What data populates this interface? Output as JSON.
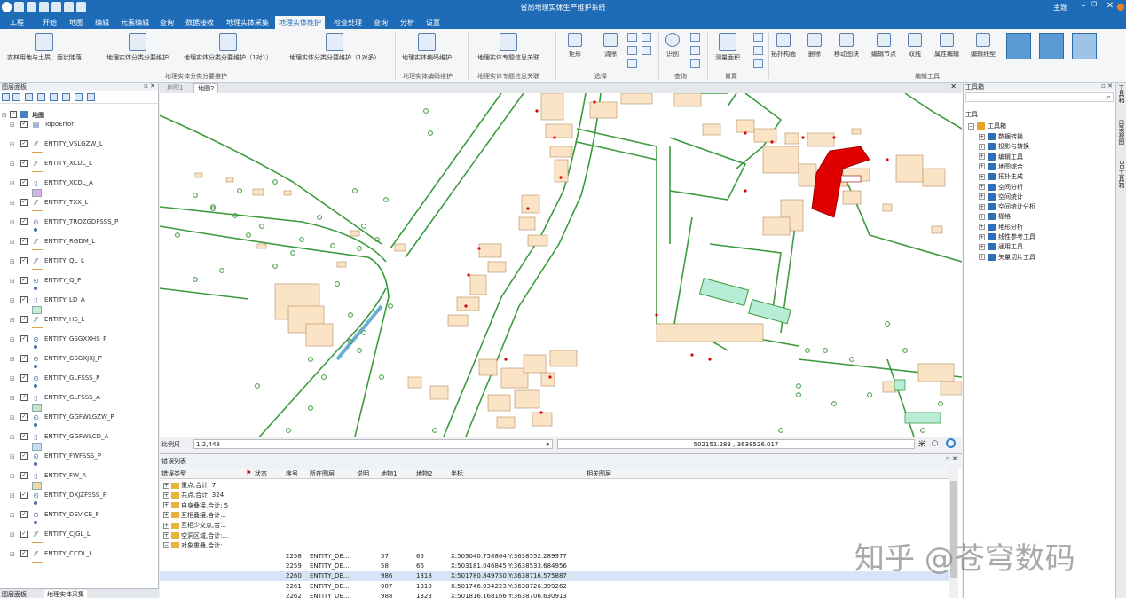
{
  "app": {
    "title": "省局地理实体生产维护系统",
    "theme_label": "主题"
  },
  "menu": [
    "工程",
    "开始",
    "地图",
    "编辑",
    "元素编辑",
    "查询",
    "数据接收",
    "地理实体采集",
    "地理实体维护",
    "检查处理",
    "查询",
    "分析",
    "设置"
  ],
  "ribbon": {
    "buttons": [
      {
        "label": "农林用地与土质、面状陡落"
      },
      {
        "label": "地理实体分类分要维护"
      },
      {
        "label": "地理实体分类分要维护（1对1）"
      },
      {
        "label": "地理实体分类分要维护（1对多）"
      },
      {
        "label": "地理实体编码维护"
      },
      {
        "label": "地理实体专题信息关联"
      }
    ],
    "small_labels": {
      "rect": "矩形",
      "clear": "清除",
      "identify": "识别",
      "measure": "测量面积",
      "split": "拓扑构面",
      "delete": "删除",
      "move_node": "移动图块",
      "edit_node": "编辑节点",
      "double_line": "双线",
      "attr_edit": "属性编辑",
      "edit_line": "编辑线型"
    },
    "groups": {
      "g1": "地理实体分类分要维护",
      "g2": "地理实体编码维护",
      "g3": "地理实体专题信息关联",
      "select": "选择",
      "query": "查询",
      "measure": "量算",
      "edit_tools": "编辑工具"
    }
  },
  "layer_panel": {
    "title": "图层面板",
    "root": "地图",
    "layers": [
      {
        "name": "TopoError",
        "icon": "topo-icon"
      },
      {
        "name": "ENTITY_VSLGZW_L",
        "icon": "line-icon"
      },
      {
        "name": "ENTITY_XCDL_L",
        "icon": "line-icon"
      },
      {
        "name": "ENTITY_XCDL_A",
        "icon": "polygon-icon"
      },
      {
        "name": "ENTITY_TXX_L",
        "icon": "line-icon"
      },
      {
        "name": "ENTITY_TRQZGDFSSS_P",
        "icon": "point-icon"
      },
      {
        "name": "ENTITY_RGDM_L",
        "icon": "line-icon"
      },
      {
        "name": "ENTITY_QL_L",
        "icon": "line-icon"
      },
      {
        "name": "ENTITY_Q_P",
        "icon": "point-icon"
      },
      {
        "name": "ENTITY_LD_A",
        "icon": "polygon-icon"
      },
      {
        "name": "ENTITY_HS_L",
        "icon": "line-icon"
      },
      {
        "name": "ENTITY_GSGXXHS_P",
        "icon": "point-icon"
      },
      {
        "name": "ENTITY_GSGXJXJ_P",
        "icon": "point-icon"
      },
      {
        "name": "ENTITY_GLFSSS_P",
        "icon": "point-icon"
      },
      {
        "name": "ENTITY_GLFSSS_A",
        "icon": "polygon-icon"
      },
      {
        "name": "ENTITY_GGFWLGZW_P",
        "icon": "point-icon"
      },
      {
        "name": "ENTITY_GGFWLCD_A",
        "icon": "polygon-icon"
      },
      {
        "name": "ENTITY_FWFSSS_P",
        "icon": "point-icon"
      },
      {
        "name": "ENTITY_FW_A",
        "icon": "polygon-icon"
      },
      {
        "name": "ENTITY_DXJZFSSS_P",
        "icon": "point-icon"
      },
      {
        "name": "ENTITY_DEVICE_P",
        "icon": "point-icon"
      },
      {
        "name": "ENTITY_CJGL_L",
        "icon": "line-icon"
      },
      {
        "name": "ENTITY_CCDL_L",
        "icon": "line-icon"
      }
    ],
    "bottom_tabs": [
      "图层面板",
      "地理实体采集"
    ]
  },
  "map": {
    "tabs": [
      "地图1",
      "地图2"
    ],
    "scale_label": "比例尺",
    "scale_value": "1:2,448",
    "coordinates": "502151.283 , 3638526.017",
    "colors": {
      "building": "#fbe4c6",
      "building_stroke": "#b58a5a",
      "road": "#3c9a3c",
      "highlight": "#e00000",
      "water": "#b7ecd6"
    }
  },
  "error_list": {
    "title": "错误列表",
    "columns": [
      "错误类型",
      "状态",
      "序号",
      "所在图层",
      "说明",
      "地物1",
      "地物2",
      "坐标",
      "相关图层"
    ],
    "groups": [
      "重点,合计: 7",
      "共点,合计: 324",
      "自身叠接,合计: 5",
      "互相叠接,合计...",
      "互相少交点,合...",
      "空洞区域,合计:...",
      "对象重叠,合计:..."
    ],
    "rows": [
      {
        "seq": "2258",
        "layer": "ENTITY_DE...",
        "f1": "57",
        "f2": "65",
        "coord": "X:503040.758864 Y:3638552.289977"
      },
      {
        "seq": "2259",
        "layer": "ENTITY_DE...",
        "f1": "58",
        "f2": "66",
        "coord": "X:503181.046845 Y:3638533.684956"
      },
      {
        "seq": "2260",
        "layer": "ENTITY_DE...",
        "f1": "986",
        "f2": "1318",
        "coord": "X:501780.849750 Y:3638716.575887"
      },
      {
        "seq": "2261",
        "layer": "ENTITY_DE...",
        "f1": "987",
        "f2": "1319",
        "coord": "X:501746.934223 Y:3638726.399262"
      },
      {
        "seq": "2262",
        "layer": "ENTITY_DE...",
        "f1": "988",
        "f2": "1323",
        "coord": "X:501816.168166 Y:3638706.630913"
      }
    ]
  },
  "toolbox": {
    "title": "工具箱",
    "section": "工具",
    "root": "工具箱",
    "items": [
      "数据转换",
      "投影与转换",
      "编辑工具",
      "地图综合",
      "拓扑生成",
      "空间分析",
      "空间统计",
      "空间统计分析",
      "栅格",
      "地形分析",
      "线性参考工具",
      "通用工具",
      "矢量切片工具"
    ]
  },
  "side_strip": [
    "工具箱",
    "目录视图",
    "3D工具箱"
  ],
  "watermark": "知乎 @苍穹数码"
}
